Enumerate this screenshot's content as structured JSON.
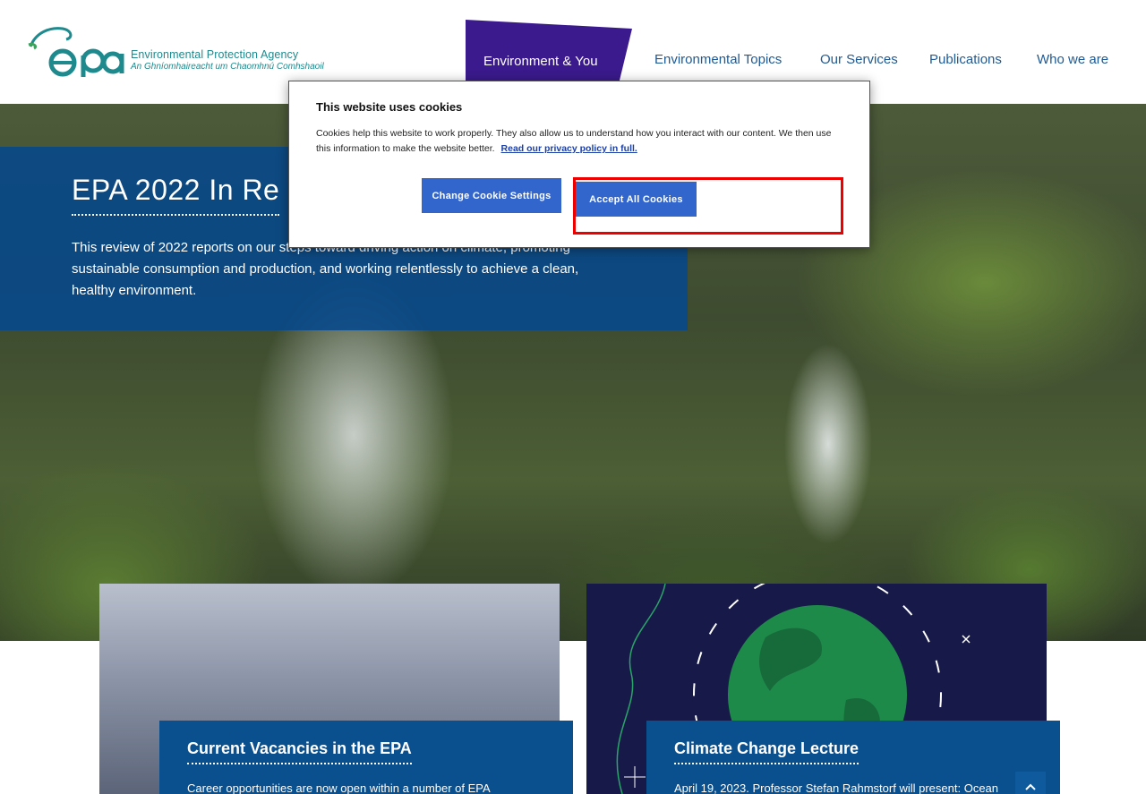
{
  "header": {
    "logo_en": "Environmental Protection Agency",
    "logo_ga": "An Ghníomhaireacht um Chaomhnú Comhshaoil",
    "nav": [
      {
        "label": "Environment & You",
        "active": true
      },
      {
        "label": "Environmental Topics"
      },
      {
        "label": "Our Services"
      },
      {
        "label": "Publications"
      },
      {
        "label": "Who we are"
      }
    ]
  },
  "hero": {
    "title": "EPA 2022 In Re",
    "text": "This review of 2022 reports on our steps toward driving action on climate, promoting sustainable consumption and production, and working relentlessly to achieve a clean, healthy environment."
  },
  "cards": [
    {
      "title": "Current Vacancies in the EPA",
      "text": "Career opportunities are now open within a number of EPA"
    },
    {
      "title": "Climate Change Lecture",
      "text": "April 19, 2023. Professor Stefan Rahmstorf will present: Ocean"
    }
  ],
  "cookie": {
    "title": "This website uses cookies",
    "text": "Cookies help this website to work properly. They also allow us to understand how you interact with our content. We then use this information to make the website better.",
    "link": "Read our privacy policy in full.",
    "settings_button": "Change Cookie Settings",
    "accept_button": "Accept All Cookies"
  },
  "colors": {
    "brand_blue": "#0a4f8e",
    "nav_active": "#3a1a8c",
    "button": "#3366cc",
    "highlight": "#e00000"
  },
  "icons": {
    "scroll_top": "chevron-up-icon",
    "logo": "epa-logo-icon"
  }
}
